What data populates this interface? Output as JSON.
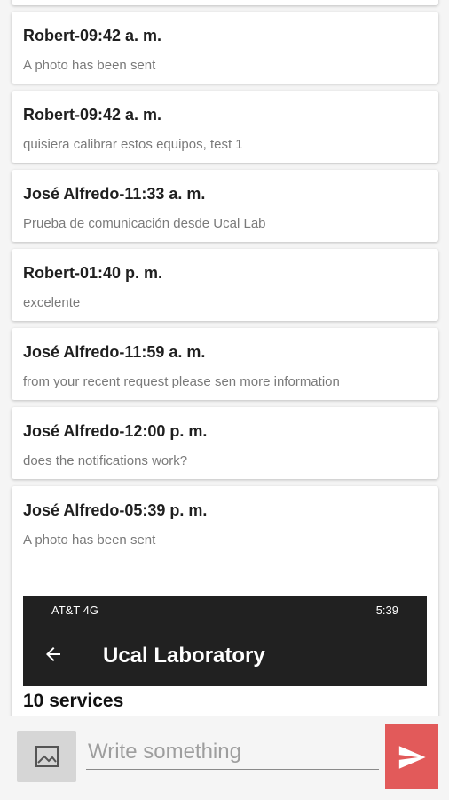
{
  "messages": [
    {
      "title": "Robert-09:42 a. m.",
      "text": "A photo has been sent"
    },
    {
      "title": "Robert-09:42 a. m.",
      "text": "quisiera calibrar estos equipos, test 1"
    },
    {
      "title": "José Alfredo-11:33 a. m.",
      "text": "Prueba de comunicación desde Ucal Lab"
    },
    {
      "title": "Robert-01:40 p. m.",
      "text": "excelente"
    },
    {
      "title": "José Alfredo-11:59 a. m.",
      "text": "from your recent request please sen more information"
    },
    {
      "title": "José Alfredo-12:00 p. m.",
      "text": "does the notifications work?"
    },
    {
      "title": "José Alfredo-05:39 p. m.",
      "text": "A photo has been sent"
    }
  ],
  "photo": {
    "status_left": "AT&T 4G",
    "status_right": "5:39",
    "app_title": "Ucal Laboratory",
    "services": "10 services"
  },
  "composer": {
    "placeholder": "Write something"
  },
  "colors": {
    "send_button": "#e25a5a",
    "image_button": "#d6d6d6",
    "photo_toolbar": "#212121"
  }
}
